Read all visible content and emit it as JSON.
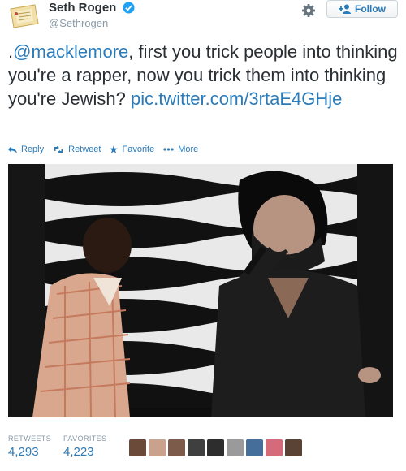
{
  "user": {
    "display_name": "Seth Rogen",
    "handle": "@Sethrogen",
    "verified": true
  },
  "header": {
    "follow_label": "Follow",
    "settings_icon": "gear-icon",
    "follow_icon": "add-user-icon"
  },
  "tweet": {
    "text_prefix": ".",
    "mention": "@macklemore",
    "text_body": ", first you trick people into thinking you're a rapper, now you trick them into thinking you're Jewish?",
    "link": "pic.twitter.com/3rtaE4GHje"
  },
  "actions": {
    "reply": "Reply",
    "retweet": "Retweet",
    "favorite": "Favorite",
    "more": "More"
  },
  "stats": {
    "retweets_label": "RETWEETS",
    "retweets_value": "4,293",
    "favorites_label": "FAVORITES",
    "favorites_value": "4,223"
  },
  "colors": {
    "link": "#2b7bb9",
    "text": "#292f33",
    "muted": "#8899a6"
  }
}
